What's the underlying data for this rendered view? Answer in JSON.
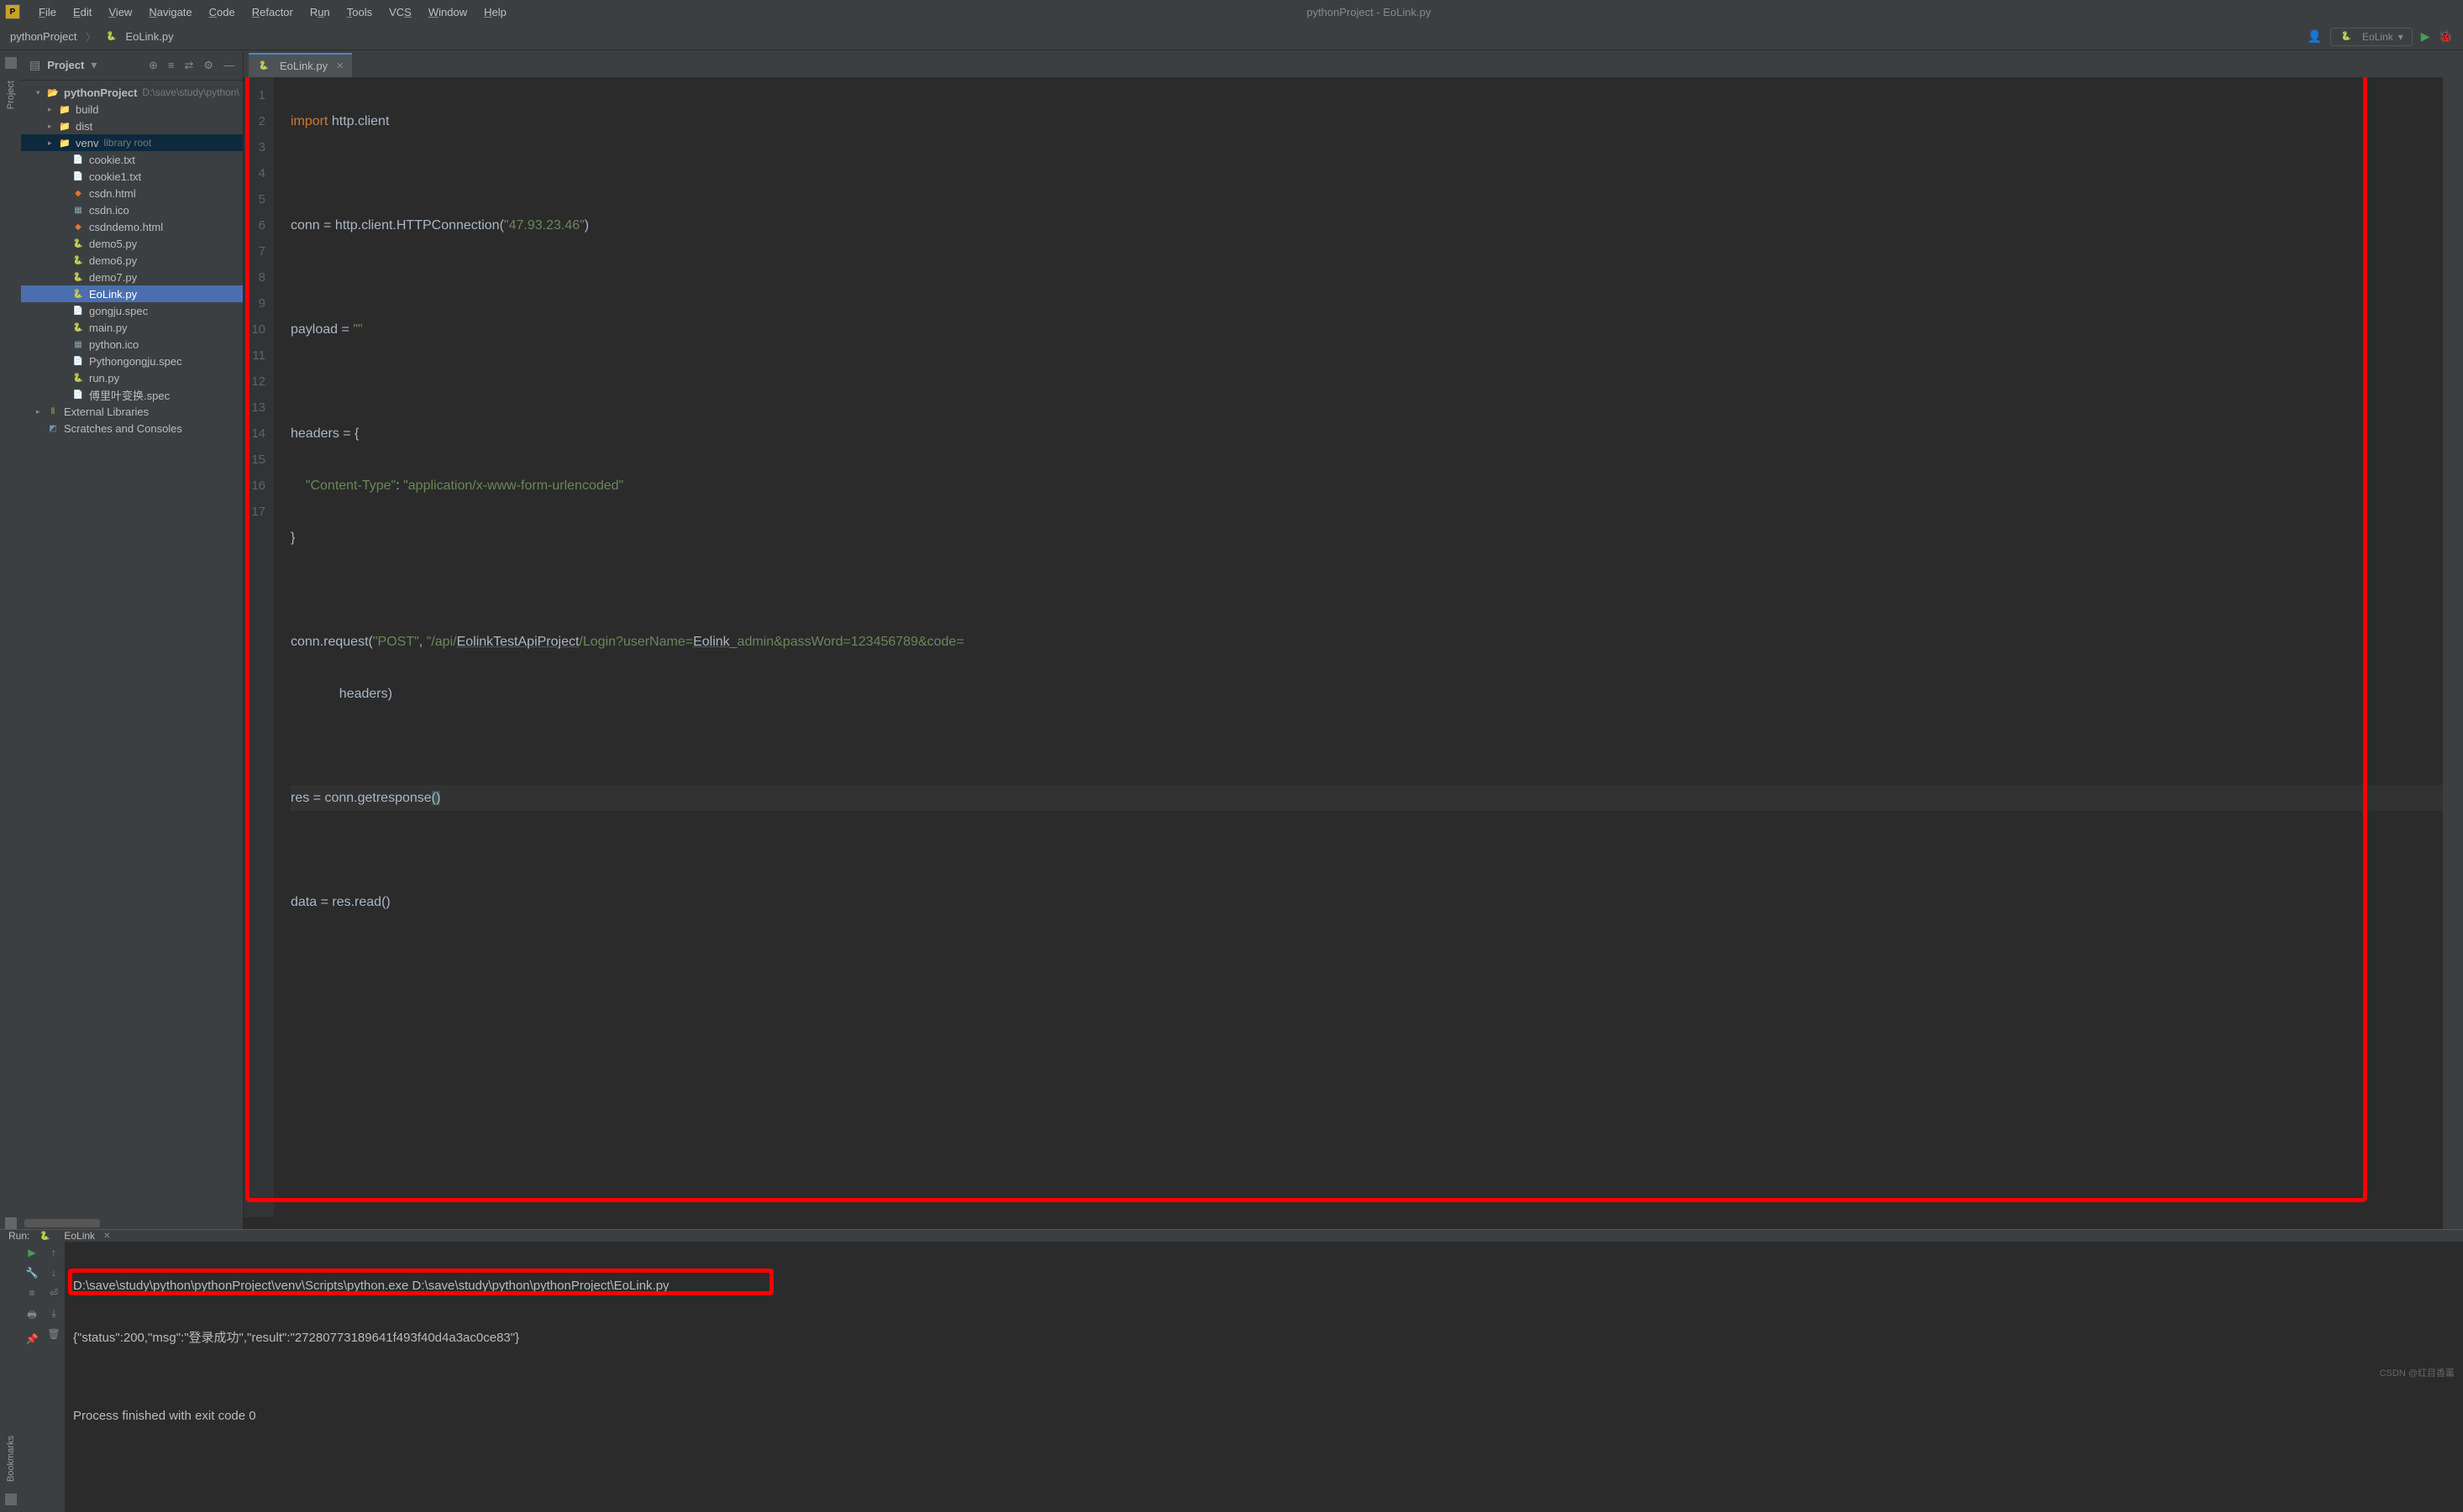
{
  "window_title": "pythonProject - EoLink.py",
  "menu": [
    "File",
    "Edit",
    "View",
    "Navigate",
    "Code",
    "Refactor",
    "Run",
    "Tools",
    "VCS",
    "Window",
    "Help"
  ],
  "breadcrumb": {
    "project": "pythonProject",
    "file": "EoLink.py"
  },
  "run_config_label": "EoLink",
  "project_label": "Project",
  "tree": {
    "root": {
      "name": "pythonProject",
      "hint": "D:\\save\\study\\python\\"
    },
    "build": "build",
    "dist": "dist",
    "venv": {
      "name": "venv",
      "hint": "library root"
    },
    "files": [
      {
        "n": "cookie.txt",
        "t": "txtfile"
      },
      {
        "n": "cookie1.txt",
        "t": "txtfile"
      },
      {
        "n": "csdn.html",
        "t": "htmlfile"
      },
      {
        "n": "csdn.ico",
        "t": "icofile"
      },
      {
        "n": "csdndemo.html",
        "t": "htmlfile"
      },
      {
        "n": "demo5.py",
        "t": "pyfile"
      },
      {
        "n": "demo6.py",
        "t": "pyfile"
      },
      {
        "n": "demo7.py",
        "t": "pyfile"
      },
      {
        "n": "EoLink.py",
        "t": "pyfile",
        "sel": true
      },
      {
        "n": "gongju.spec",
        "t": "specfile"
      },
      {
        "n": "main.py",
        "t": "pyfile"
      },
      {
        "n": "python.ico",
        "t": "icofile"
      },
      {
        "n": "Pythongongju.spec",
        "t": "specfile"
      },
      {
        "n": "run.py",
        "t": "pyfile"
      },
      {
        "n": "傅里叶变换.spec",
        "t": "specfile"
      }
    ],
    "ext": "External Libraries",
    "scratches": "Scratches and Consoles"
  },
  "tab": {
    "name": "EoLink.py"
  },
  "code_lines": {
    "l1_kw": "import",
    "l1_rest": " http.client",
    "l3": "conn = http.client.HTTPConnection(",
    "l3_str": "\"47.93.23.46\"",
    "l3_end": ")",
    "l5": "payload = ",
    "l5_str": "\"\"",
    "l7": "headers = {",
    "l8_str": "    \"Content-Type\"",
    "l8_mid": ": ",
    "l8_str2": "\"application/x-www-form-urlencoded\"",
    "l9": "}",
    "l11a": "conn.request(",
    "l11s1": "\"POST\"",
    "l11c": ", ",
    "l11s2": "\"/api/",
    "l11u": "EolinkTestApiProject",
    "l11s3": "/Login?userName=",
    "l11u2": "Eolink",
    "l11s4": "_admin&passWord=123456789&code=",
    "l12": "             headers)",
    "l14": "res = conn.getresponse",
    "l14p": "()",
    "l16": "data = res.read()"
  },
  "gutter_lines": [
    "1",
    "2",
    "3",
    "4",
    "5",
    "6",
    "7",
    "8",
    "9",
    "10",
    "11",
    "12",
    "13",
    "14",
    "15",
    "16",
    "17"
  ],
  "run": {
    "label": "Run:",
    "name": "EoLink",
    "line1": "D:\\save\\study\\python\\pythonProject\\venv\\Scripts\\python.exe D:\\save\\study\\python\\pythonProject\\EoLink.py",
    "line2": "{\"status\":200,\"msg\":\"登录成功\",\"result\":\"27280773189641f493f40d4a3ac0ce83\"}",
    "line3": "",
    "line4": "Process finished with exit code 0"
  },
  "sidebar_labels": {
    "project": "Project",
    "bookmarks": "Bookmarks"
  },
  "watermark": "CSDN @红目香薰"
}
